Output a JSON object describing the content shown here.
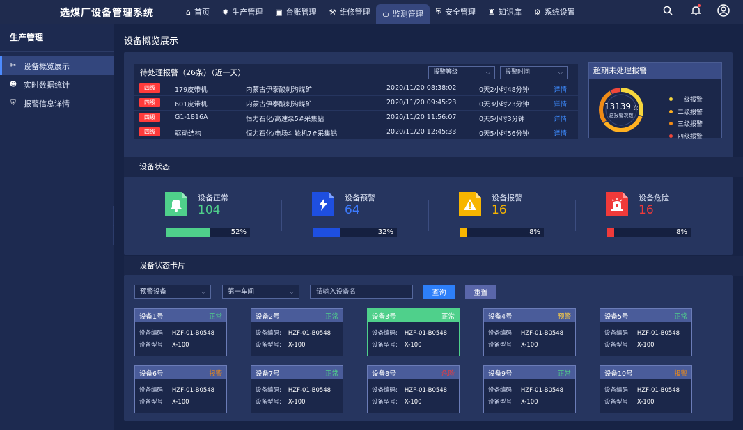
{
  "app_title": "选煤厂设备管理系统",
  "nav": [
    {
      "label": "首页",
      "icon": "home-icon"
    },
    {
      "label": "生产管理",
      "icon": "gear-icon"
    },
    {
      "label": "台账管理",
      "icon": "ledger-icon"
    },
    {
      "label": "维修管理",
      "icon": "wrench-icon"
    },
    {
      "label": "监测管理",
      "icon": "monitor-icon",
      "active": true
    },
    {
      "label": "安全管理",
      "icon": "shield-icon"
    },
    {
      "label": "知识库",
      "icon": "graduation-cap-icon"
    },
    {
      "label": "系统设置",
      "icon": "settings-icon"
    }
  ],
  "sidebar": {
    "title": "生产管理",
    "items": [
      {
        "label": "设备概览展示",
        "icon": "tools-icon",
        "active": true
      },
      {
        "label": "实时数据统计",
        "icon": "user-stats-icon"
      },
      {
        "label": "报警信息详情",
        "icon": "shield-icon"
      }
    ]
  },
  "page_title": "设备概览展示",
  "alarms": {
    "title": "待处理报警（26条）（近一天）",
    "filter_level": "报警等级",
    "filter_time": "报警时间",
    "rows": [
      {
        "level": "四级",
        "device": "179皮带机",
        "location": "内蒙古伊泰酸刺沟煤矿",
        "time": "2020/11/20 08:38:02",
        "duration": "0天2小时48分钟",
        "action": "详情"
      },
      {
        "level": "四级",
        "device": "601皮带机",
        "location": "内蒙古伊泰酸刺沟煤矿",
        "time": "2020/11/20 09:45:23",
        "duration": "0天3小时23分钟",
        "action": "详情"
      },
      {
        "level": "四级",
        "device": "G1-1816A",
        "location": "恒力石化/高速泵5#采集钻",
        "time": "2020/11/20 11:56:07",
        "duration": "0天5小时3分钟",
        "action": "详情"
      },
      {
        "level": "四级",
        "device": "驱动结构",
        "location": "恒力石化/电场斗轮机7#采集钻",
        "time": "2020/11/20 12:45:33",
        "duration": "0天5小时56分钟",
        "action": "详情"
      }
    ]
  },
  "overdue": {
    "title": "超期未处理报警",
    "total": "13139",
    "unit": "次",
    "sub": "总报警次数",
    "legend": [
      {
        "label": "一级报警",
        "color": "#f5d63d",
        "share": 0.3
      },
      {
        "label": "二级报警",
        "color": "#ffb020",
        "share": 0.35
      },
      {
        "label": "三级报警",
        "color": "#f08b16",
        "share": 0.27
      },
      {
        "label": "四级报警",
        "color": "#f0473a",
        "share": 0.08
      }
    ]
  },
  "status_section_title": "设备状态",
  "status": [
    {
      "label": "设备正常",
      "value": "104",
      "percent": 52,
      "percent_label": "52%",
      "color": "#4fd08b",
      "value_color": "#4fd08b",
      "icon": "bell-icon"
    },
    {
      "label": "设备预警",
      "value": "64",
      "percent": 32,
      "percent_label": "32%",
      "color": "#1e4fe0",
      "value_color": "#3d7bff",
      "icon": "lightning-icon"
    },
    {
      "label": "设备报警",
      "value": "16",
      "percent": 8,
      "percent_label": "8%",
      "color": "#f7b500",
      "value_color": "#f7b500",
      "icon": "warning-icon"
    },
    {
      "label": "设备危险",
      "value": "16",
      "percent": 8,
      "percent_label": "8%",
      "color": "#f03a3a",
      "value_color": "#f03a3a",
      "icon": "siren-icon"
    }
  ],
  "cards_section_title": "设备状态卡片",
  "filters": {
    "type": "预警设备",
    "workshop": "第一车间",
    "search_placeholder": "请输入设备名",
    "query": "查询",
    "reset": "重置"
  },
  "card_labels": {
    "code": "设备编码:",
    "model": "设备型号:"
  },
  "cards": [
    {
      "name": "设备1号",
      "status": "正常",
      "status_color": "#4fd08b",
      "code": "HZF-01-B0548",
      "model": "X-100"
    },
    {
      "name": "设备2号",
      "status": "正常",
      "status_color": "#4fd08b",
      "code": "HZF-01-B0548",
      "model": "X-100"
    },
    {
      "name": "设备3号",
      "status": "正常",
      "status_color": "#ffffff",
      "code": "HZF-01-B0548",
      "model": "X-100",
      "highlight": true
    },
    {
      "name": "设备4号",
      "status": "预警",
      "status_color": "#f7c948",
      "code": "HZF-01-B0548",
      "model": "X-100"
    },
    {
      "name": "设备5号",
      "status": "正常",
      "status_color": "#4fd08b",
      "code": "HZF-01-B0548",
      "model": "X-100"
    },
    {
      "name": "设备6号",
      "status": "报警",
      "status_color": "#f08b16",
      "code": "HZF-01-B0548",
      "model": "X-100"
    },
    {
      "name": "设备7号",
      "status": "正常",
      "status_color": "#4fd08b",
      "code": "HZF-01-B0548",
      "model": "X-100"
    },
    {
      "name": "设备8号",
      "status": "危险",
      "status_color": "#f03a3a",
      "code": "HZF-01-B0548",
      "model": "X-100"
    },
    {
      "name": "设备9号",
      "status": "正常",
      "status_color": "#4fd08b",
      "code": "HZF-01-B0548",
      "model": "X-100"
    },
    {
      "name": "设备10号",
      "status": "报警",
      "status_color": "#f08b16",
      "code": "HZF-01-B0548",
      "model": "X-100"
    }
  ]
}
